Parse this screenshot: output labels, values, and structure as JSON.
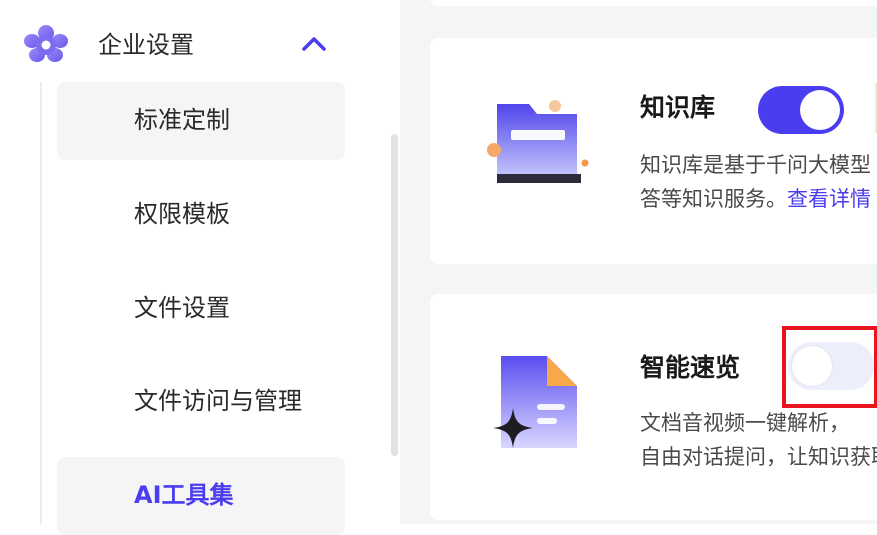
{
  "sidebar": {
    "group": {
      "title": "企业设置",
      "icon": "flower-gear-icon",
      "expanded": true
    },
    "items": [
      {
        "label": "标准定制",
        "active": false
      },
      {
        "label": "权限模板",
        "active": false
      },
      {
        "label": "文件设置",
        "active": false
      },
      {
        "label": "文件访问与管理",
        "active": false
      },
      {
        "label": "AI工具集",
        "active": true
      }
    ]
  },
  "cards": [
    {
      "title": "知识库",
      "icon": "knowledge-base-folder-icon",
      "enabled": true,
      "desc_line1": "知识库是基于千问大模型",
      "desc_line2": "答等知识服务。",
      "link": "查看详情"
    },
    {
      "title": "智能速览",
      "icon": "smart-preview-document-icon",
      "enabled": false,
      "desc_line1": "文档音视频一键解析，",
      "desc_line2": "自由对话提问，让知识获取"
    }
  ],
  "colors": {
    "accent": "#4a3df0",
    "toggle_off": "#eceefb",
    "highlight": "#e8141e",
    "main_bg": "#f4f5f7",
    "menu_hover": "#f5f5f5"
  }
}
